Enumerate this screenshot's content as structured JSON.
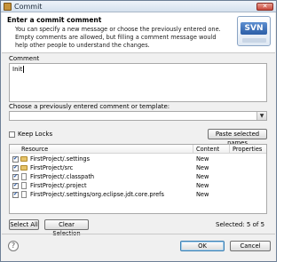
{
  "window": {
    "title": "Commit",
    "close_symbol": "✕"
  },
  "header": {
    "title": "Enter a commit comment",
    "description": "You can specify a new message or choose the previously entered one. Empty comments are allowed, but filling a comment message would help other people to understand the changes.",
    "logo_text": "SVN"
  },
  "comment": {
    "label": "Comment",
    "value": "Init"
  },
  "template": {
    "label": "Choose a previously entered comment or template:",
    "selected": ""
  },
  "keep_locks": {
    "label": "Keep Locks",
    "checked": false
  },
  "paste_button": "Paste selected names",
  "table": {
    "columns": [
      "Resource",
      "Content",
      "Properties"
    ],
    "rows": [
      {
        "icon": "folder-icon",
        "resource": "FirstProject/.settings",
        "content": "New",
        "properties": ""
      },
      {
        "icon": "folder-icon",
        "resource": "FirstProject/src",
        "content": "New",
        "properties": ""
      },
      {
        "icon": "file-icon",
        "resource": "FirstProject/.classpath",
        "content": "New",
        "properties": ""
      },
      {
        "icon": "file-icon",
        "resource": "FirstProject/.project",
        "content": "New",
        "properties": ""
      },
      {
        "icon": "file-icon",
        "resource": "FirstProject/.settings/org.eclipse.jdt.core.prefs",
        "content": "New",
        "properties": ""
      }
    ]
  },
  "select_all": "Select All",
  "clear_selection": "Clear Selection",
  "selected_status": "Selected: 5 of 5",
  "help_symbol": "?",
  "ok": "OK",
  "cancel": "Cancel"
}
